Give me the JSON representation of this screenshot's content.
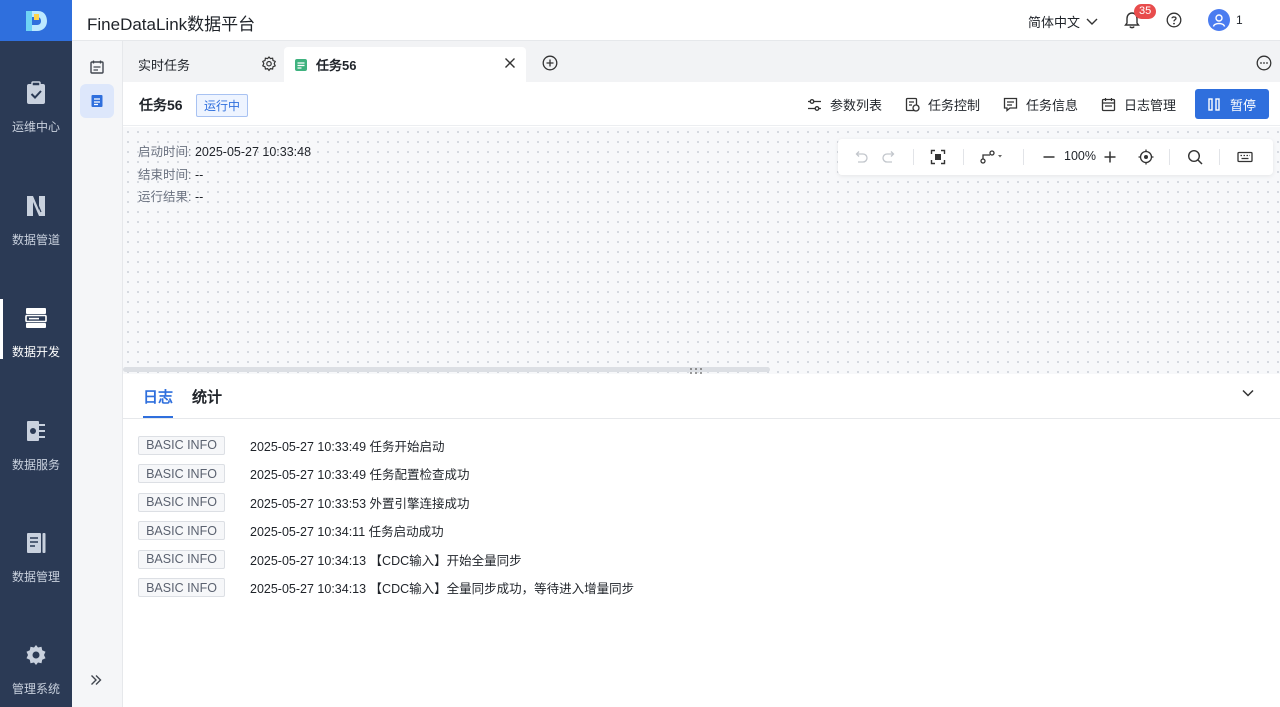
{
  "app": {
    "title": "FineDataLink数据平台",
    "brand_color": "#2f6fdd",
    "nav_bg": "#2b3a55"
  },
  "header": {
    "language": "简体中文",
    "notification_count": "35",
    "user_name": "1"
  },
  "nav": {
    "items": [
      {
        "label": "运维中心",
        "icon": "clipboard-check-icon"
      },
      {
        "label": "数据管道",
        "icon": "pipeline-icon"
      },
      {
        "label": "数据开发",
        "icon": "server-stack-icon",
        "active": true
      },
      {
        "label": "数据服务",
        "icon": "service-icon"
      },
      {
        "label": "数据管理",
        "icon": "data-manage-icon"
      },
      {
        "label": "管理系统",
        "icon": "gear-icon"
      }
    ]
  },
  "tabs": {
    "items": [
      {
        "label": "实时任务"
      },
      {
        "label": "任务56"
      }
    ]
  },
  "task": {
    "name": "任务56",
    "status": "运行中",
    "actions": {
      "params": "参数列表",
      "control": "任务控制",
      "info": "任务信息",
      "logs": "日志管理",
      "pause": "暂停"
    }
  },
  "canvas": {
    "start_label": "启动时间:",
    "start_value": "2025-05-27 10:33:48",
    "end_label": "结束时间:",
    "end_value": "--",
    "result_label": "运行结果:",
    "result_value": "--",
    "zoom": "100%"
  },
  "log": {
    "tabs": [
      "日志",
      "统计"
    ],
    "entries": [
      {
        "level": "BASIC INFO",
        "message": "2025-05-27 10:33:49 任务开始启动"
      },
      {
        "level": "BASIC INFO",
        "message": "2025-05-27 10:33:49 任务配置检查成功"
      },
      {
        "level": "BASIC INFO",
        "message": "2025-05-27 10:33:53 外置引擎连接成功"
      },
      {
        "level": "BASIC INFO",
        "message": "2025-05-27 10:34:11 任务启动成功"
      },
      {
        "level": "BASIC INFO",
        "message": "2025-05-27 10:34:13 【CDC输入】开始全量同步"
      },
      {
        "level": "BASIC INFO",
        "message": "2025-05-27 10:34:13 【CDC输入】全量同步成功，等待进入增量同步"
      }
    ]
  }
}
